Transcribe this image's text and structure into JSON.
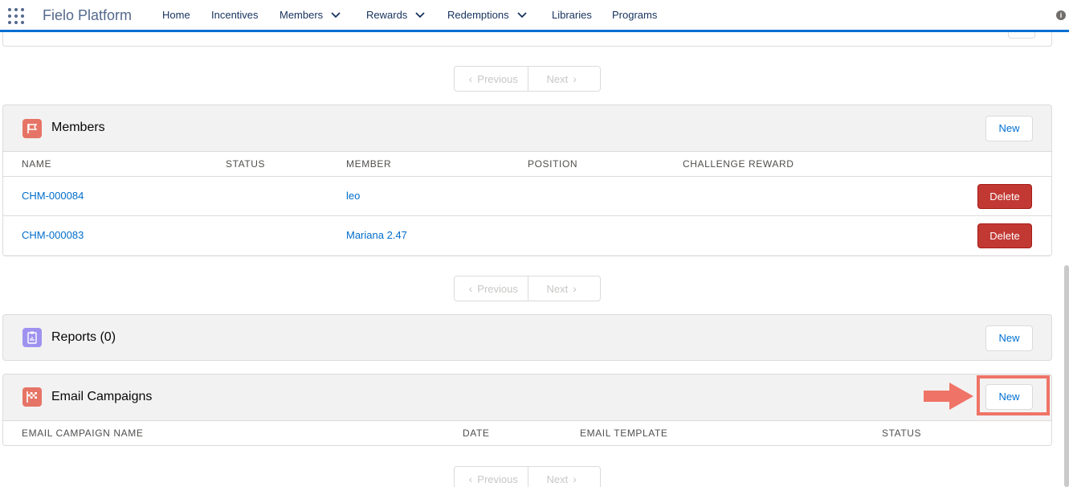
{
  "topnav": {
    "app_name": "Fielo Platform",
    "items": [
      {
        "label": "Home",
        "has_menu": false
      },
      {
        "label": "Incentives",
        "has_menu": false
      },
      {
        "label": "Members",
        "has_menu": true
      },
      {
        "label": "Rewards",
        "has_menu": true
      },
      {
        "label": "Redemptions",
        "has_menu": true
      },
      {
        "label": "Libraries",
        "has_menu": false
      },
      {
        "label": "Programs",
        "has_menu": false
      }
    ]
  },
  "pager": {
    "previous_label": "Previous",
    "next_label": "Next"
  },
  "members_card": {
    "title": "Members",
    "new_label": "New",
    "icon": "flag-icon",
    "icon_color": "#e67466",
    "columns": [
      "Name",
      "Status",
      "Member",
      "Position",
      "Challenge Reward"
    ],
    "rows": [
      {
        "name": "CHM-000084",
        "status": "",
        "member": "leo",
        "position": "",
        "challenge_reward": "",
        "delete_label": "Delete"
      },
      {
        "name": "CHM-000083",
        "status": "",
        "member": "Mariana 2.47",
        "position": "",
        "challenge_reward": "",
        "delete_label": "Delete"
      }
    ]
  },
  "reports_card": {
    "title": "Reports (0)",
    "new_label": "New",
    "icon": "report-icon",
    "icon_color": "#9e92f0"
  },
  "email_campaigns_card": {
    "title": "Email Campaigns",
    "new_label": "New",
    "icon": "checkered-flag-icon",
    "icon_color": "#e67466",
    "columns": [
      "Email Campaign Name",
      "Date",
      "Email Template",
      "Status"
    ]
  },
  "colors": {
    "brand": "#0070d2",
    "link": "#006dcc",
    "delete": "#c23934",
    "annotation": "#ef7467"
  }
}
